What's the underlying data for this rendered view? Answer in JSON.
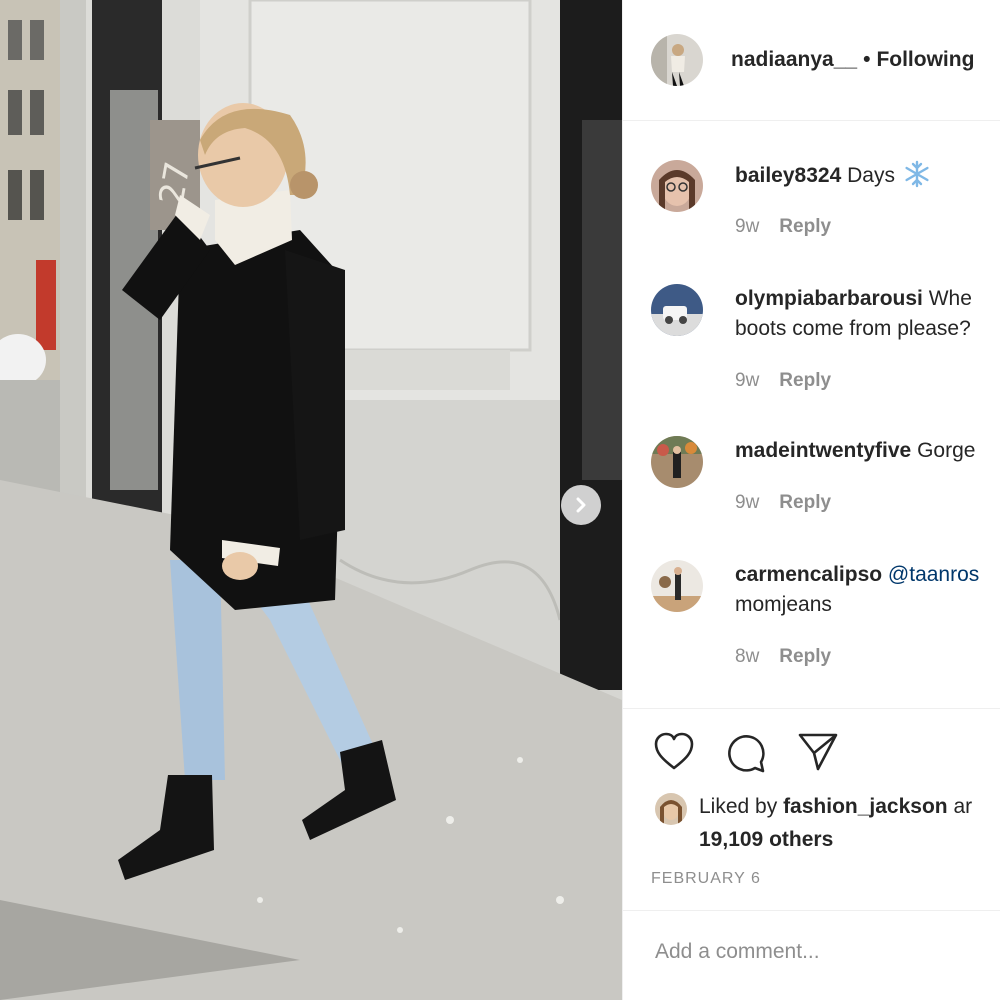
{
  "post": {
    "username": "nadiaanya__",
    "separator": "•",
    "follow_status": "Following",
    "photo_sign_text": "27"
  },
  "comments": [
    {
      "username": "bailey8324",
      "text": "Days",
      "emoji_icon": "snowflake-icon",
      "age": "9w",
      "reply": "Reply"
    },
    {
      "username": "olympiabarbarousi",
      "text": "Whe",
      "text_line2": "boots come from please?",
      "age": "9w",
      "reply": "Reply"
    },
    {
      "username": "madeintwentyfive",
      "text": "Gorge",
      "age": "9w",
      "reply": "Reply"
    },
    {
      "username": "carmencalipso",
      "mention": "@taanros",
      "text_line2": "momjeans",
      "age": "8w",
      "reply": "Reply"
    }
  ],
  "likes": {
    "prefix": "Liked by",
    "top_liker": "fashion_jackson",
    "suffix": "ar",
    "others_count": "19,109 others"
  },
  "date": "FEBRUARY 6",
  "add_comment_placeholder": "Add a comment...",
  "colors": {
    "text": "#262626",
    "muted": "#8e8e8e",
    "mention": "#00376b",
    "divider": "#efefef"
  },
  "icons": [
    "heart-icon",
    "comment-icon",
    "share-icon",
    "chevron-right-icon"
  ]
}
